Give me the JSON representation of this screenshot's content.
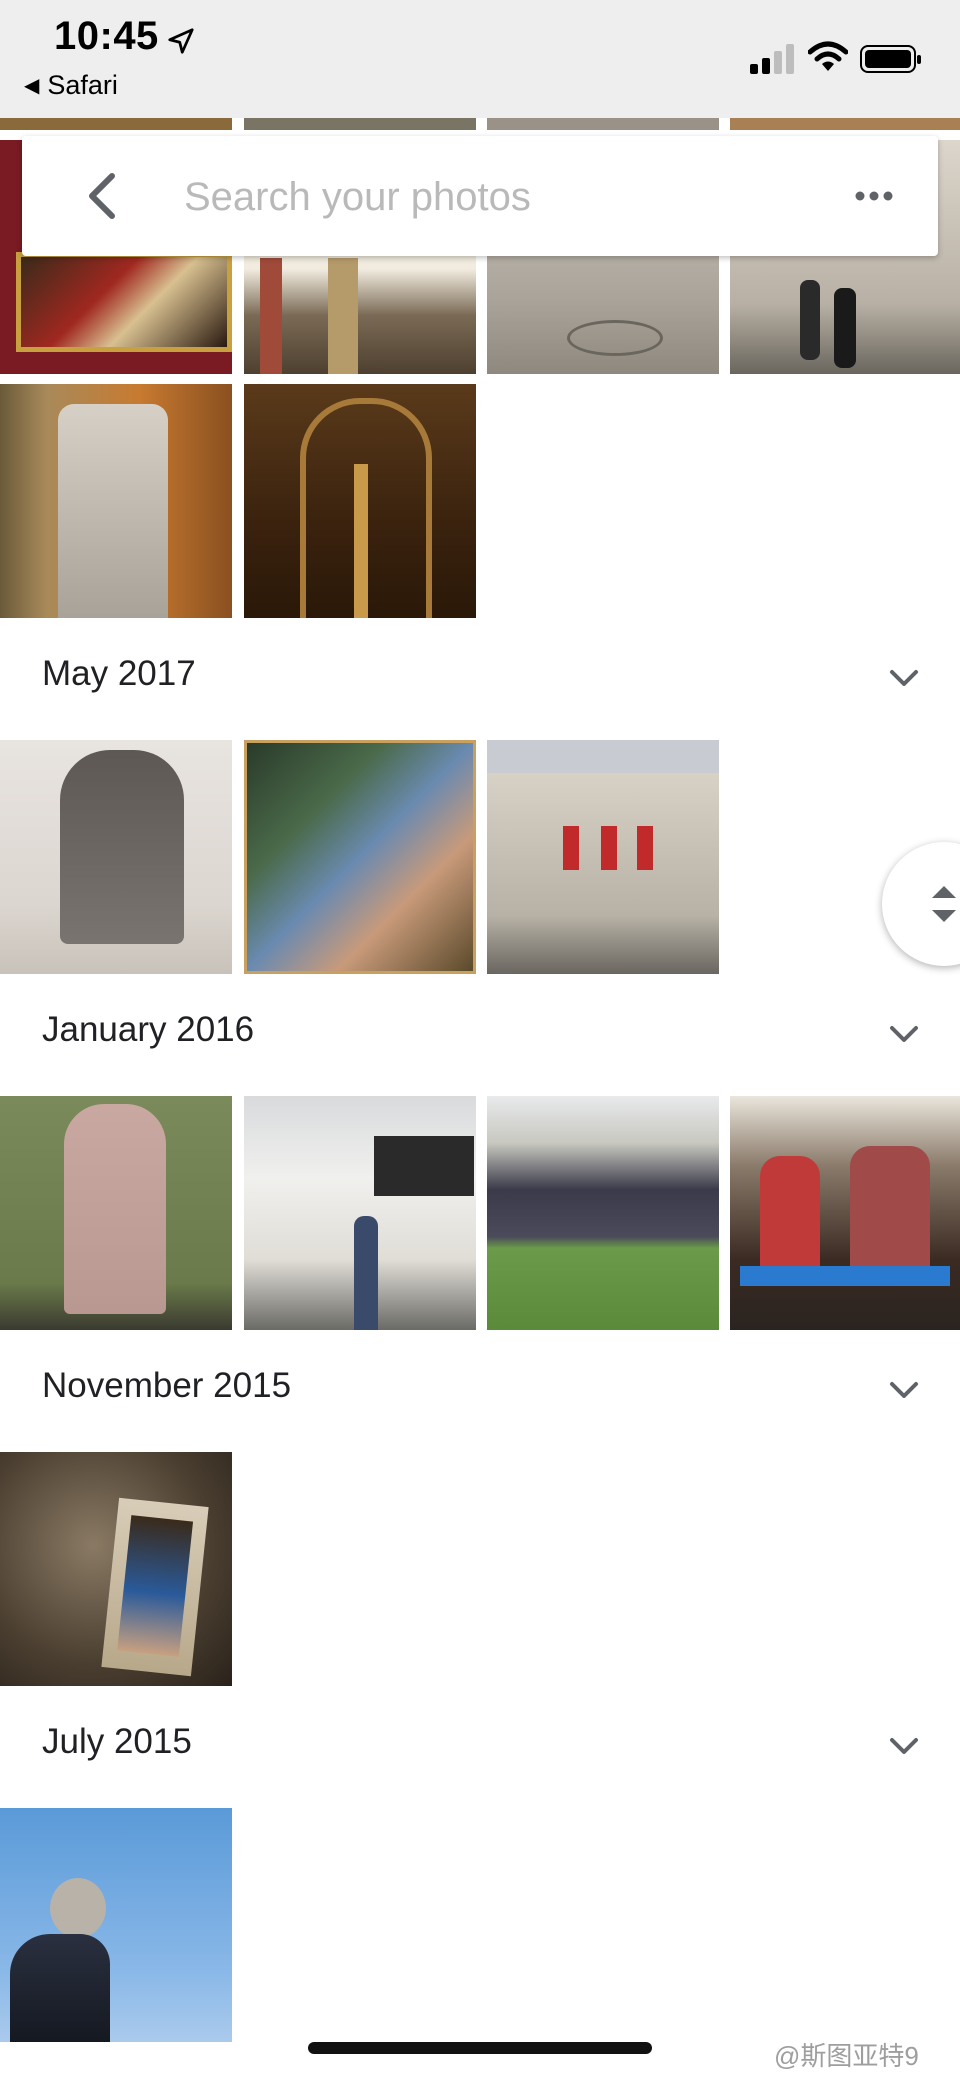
{
  "status_bar": {
    "time": "10:45",
    "back_app": "Safari",
    "location_icon": "location-arrow-icon",
    "signal_icon": "cellular-signal-icon",
    "wifi_icon": "wifi-icon",
    "battery_icon": "battery-icon"
  },
  "search": {
    "placeholder": "Search your photos",
    "back_icon": "back-arrow-icon",
    "more_icon": "more-options-icon"
  },
  "sections": [
    {
      "title": "May 2017",
      "photo_count": 3
    },
    {
      "title": "January 2016",
      "photo_count": 4
    },
    {
      "title": "November 2015",
      "photo_count": 1
    },
    {
      "title": "July 2015",
      "photo_count": 1
    }
  ],
  "colors": {
    "status_bar_bg": "#eeeeee",
    "background": "#ffffff",
    "text": "#202124",
    "placeholder": "#b9b9b9",
    "icon": "#5f6368"
  },
  "fast_scroll_icon": "fast-scroll-arrows-icon",
  "watermark": "@斯图亚特9"
}
